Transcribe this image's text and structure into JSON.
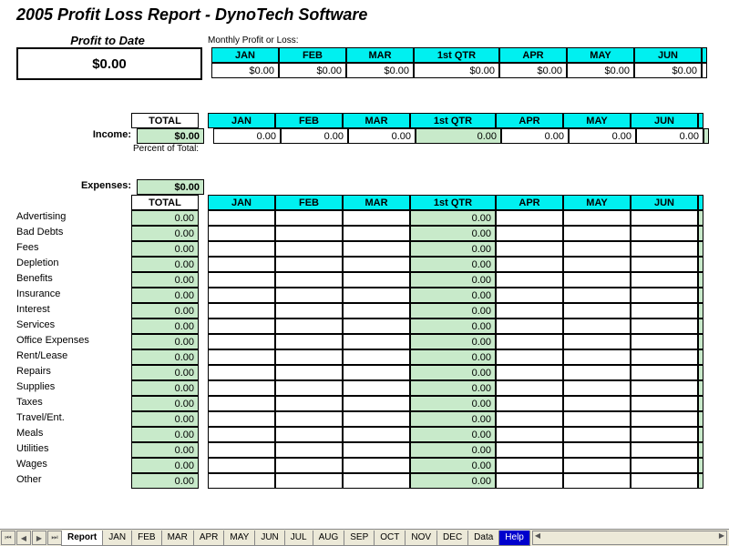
{
  "title": "2005 Profit Loss Report - DynoTech Software",
  "profit_to_date_label": "Profit to Date",
  "profit_to_date_value": "$0.00",
  "monthly_profit_label": "Monthly Profit or Loss:",
  "periods": [
    "JAN",
    "FEB",
    "MAR",
    "1st QTR",
    "APR",
    "MAY",
    "JUN"
  ],
  "profit_row": [
    "$0.00",
    "$0.00",
    "$0.00",
    "$0.00",
    "$0.00",
    "$0.00",
    "$0.00"
  ],
  "total_label": "TOTAL",
  "income_label": "Income:",
  "income_total": "$0.00",
  "income_row": [
    "0.00",
    "0.00",
    "0.00",
    "0.00",
    "0.00",
    "0.00",
    "0.00"
  ],
  "percent_of_total_label": "Percent of Total:",
  "expenses_label": "Expenses:",
  "expenses_total": "$0.00",
  "expense_items": [
    {
      "name": "Advertising",
      "total": "0.00",
      "qtr": "0.00"
    },
    {
      "name": "Bad Debts",
      "total": "0.00",
      "qtr": "0.00"
    },
    {
      "name": "Fees",
      "total": "0.00",
      "qtr": "0.00"
    },
    {
      "name": "Depletion",
      "total": "0.00",
      "qtr": "0.00"
    },
    {
      "name": "Benefits",
      "total": "0.00",
      "qtr": "0.00"
    },
    {
      "name": "Insurance",
      "total": "0.00",
      "qtr": "0.00"
    },
    {
      "name": "Interest",
      "total": "0.00",
      "qtr": "0.00"
    },
    {
      "name": "Services",
      "total": "0.00",
      "qtr": "0.00"
    },
    {
      "name": "Office Expenses",
      "total": "0.00",
      "qtr": "0.00"
    },
    {
      "name": "Rent/Lease",
      "total": "0.00",
      "qtr": "0.00"
    },
    {
      "name": "Repairs",
      "total": "0.00",
      "qtr": "0.00"
    },
    {
      "name": "Supplies",
      "total": "0.00",
      "qtr": "0.00"
    },
    {
      "name": "Taxes",
      "total": "0.00",
      "qtr": "0.00"
    },
    {
      "name": "Travel/Ent.",
      "total": "0.00",
      "qtr": "0.00"
    },
    {
      "name": "Meals",
      "total": "0.00",
      "qtr": "0.00"
    },
    {
      "name": "Utilities",
      "total": "0.00",
      "qtr": "0.00"
    },
    {
      "name": "Wages",
      "total": "0.00",
      "qtr": "0.00"
    },
    {
      "name": "Other",
      "total": "0.00",
      "qtr": "0.00"
    }
  ],
  "tabs": [
    "Report",
    "JAN",
    "FEB",
    "MAR",
    "APR",
    "MAY",
    "JUN",
    "JUL",
    "AUG",
    "SEP",
    "OCT",
    "NOV",
    "DEC",
    "Data",
    "Help"
  ],
  "active_tab": "Report"
}
